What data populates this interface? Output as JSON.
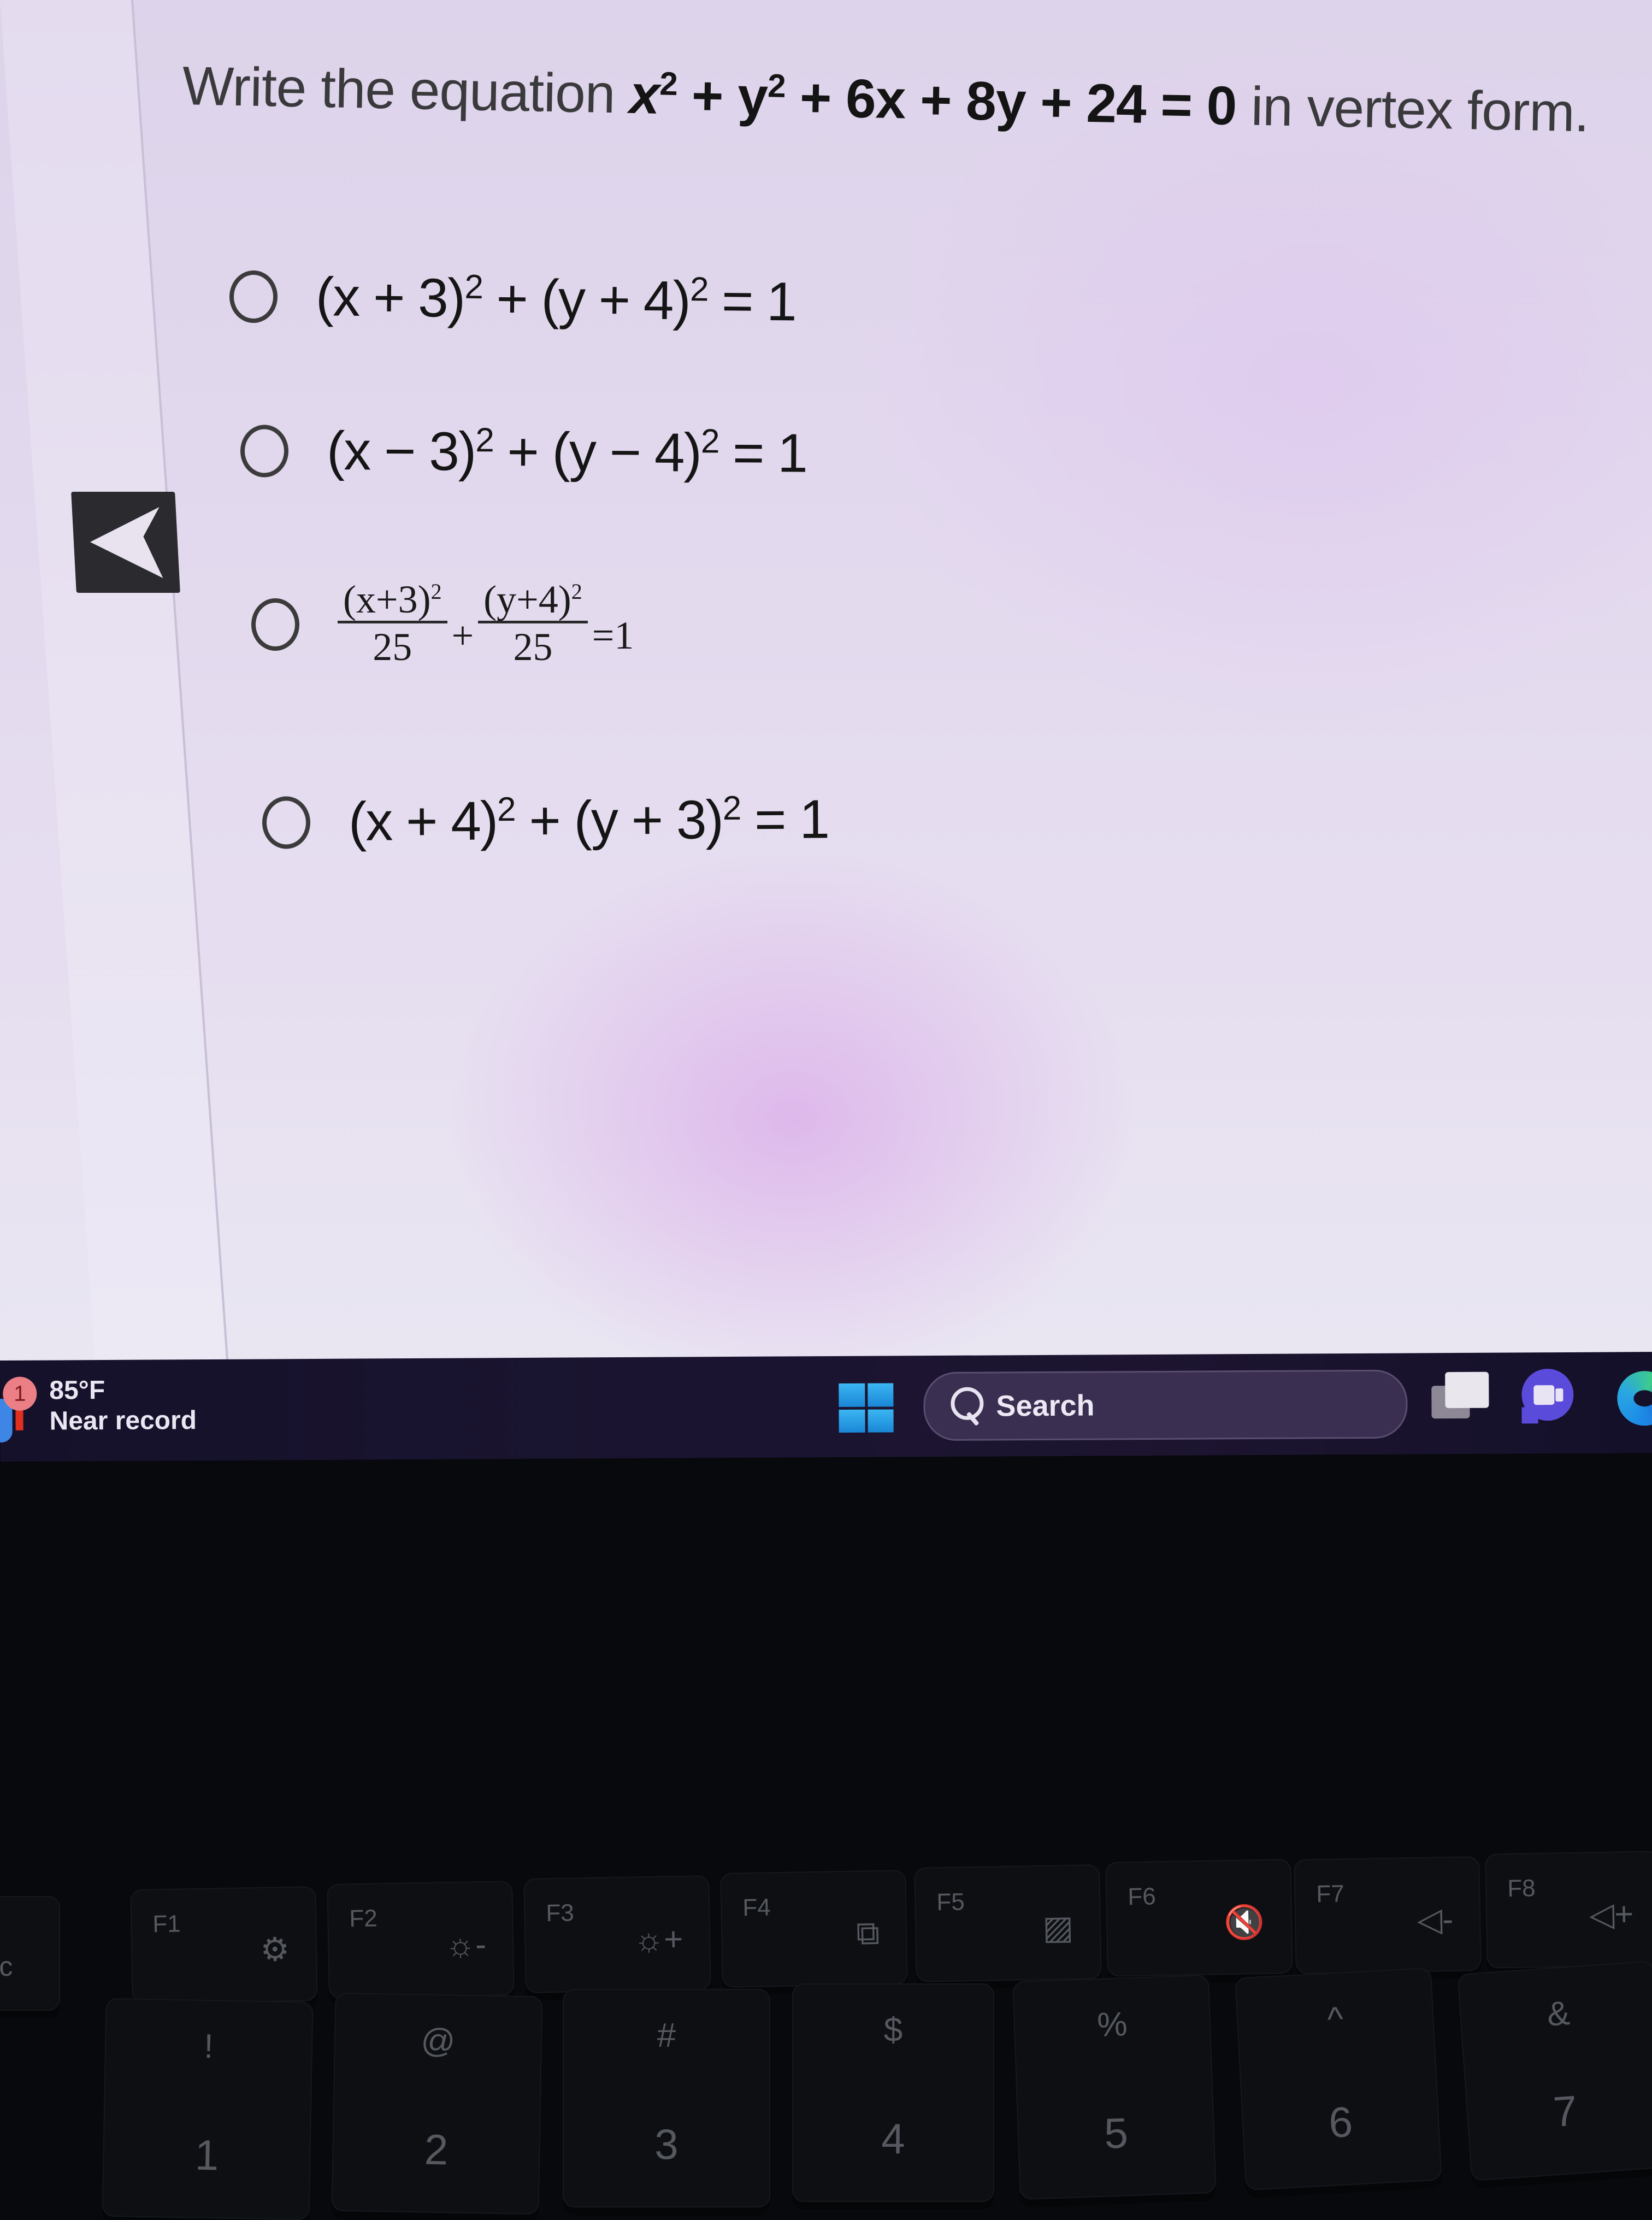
{
  "question": {
    "prefix": "Write the equation ",
    "equation_parts": [
      "x",
      "2",
      " + y",
      "2",
      " + 6x + 8y + 24 = 0"
    ],
    "suffix": " in vertex form."
  },
  "navigation": {
    "back_icon": "back-arrow-icon"
  },
  "choices": [
    {
      "parts": [
        "(x + 3)",
        "2",
        " + (y + 4)",
        "2",
        " = 1"
      ],
      "selected": false
    },
    {
      "parts": [
        "(x − 3)",
        "2",
        " + (y − 4)",
        "2",
        " = 1"
      ],
      "selected": false
    },
    {
      "fraction": {
        "num1": "(x+3)",
        "exp1": "2",
        "den1": "25",
        "op": "+",
        "num2": "(y+4)",
        "exp2": "2",
        "den2": "25",
        "rhs": "=1"
      },
      "selected": false
    },
    {
      "parts": [
        "(x + 4)",
        "2",
        " + (y + 3)",
        "2",
        " = 1"
      ],
      "selected": false
    }
  ],
  "taskbar": {
    "weather": {
      "badge": "1",
      "temperature": "85°F",
      "description": "Near record",
      "icon": "thermometer-icon"
    },
    "start_icon": "windows-start-icon",
    "search": {
      "label": "Search",
      "icon": "search-icon"
    },
    "pinned": [
      {
        "name": "task-view",
        "icon": "task-view-icon"
      },
      {
        "name": "meet",
        "icon": "video-chat-icon"
      },
      {
        "name": "edge",
        "icon": "edge-browser-icon"
      }
    ]
  },
  "keyboard": {
    "function_row": [
      {
        "label": "Esc",
        "glyph": ""
      },
      {
        "label": "F1",
        "glyph": "⚙"
      },
      {
        "label": "F2",
        "glyph": "☼-"
      },
      {
        "label": "F3",
        "glyph": "☼+"
      },
      {
        "label": "F4",
        "glyph": "⧉"
      },
      {
        "label": "F5",
        "glyph": "▨"
      },
      {
        "label": "F6",
        "glyph": "🔇"
      },
      {
        "label": "F7",
        "glyph": "◁-"
      },
      {
        "label": "F8",
        "glyph": "◁+"
      }
    ],
    "number_row": [
      {
        "shift": "!",
        "main": "1"
      },
      {
        "shift": "@",
        "main": "2"
      },
      {
        "shift": "#",
        "main": "3"
      },
      {
        "shift": "$",
        "main": "4"
      },
      {
        "shift": "%",
        "main": "5"
      },
      {
        "shift": "^",
        "main": "6"
      },
      {
        "shift": "&",
        "main": "7"
      }
    ]
  }
}
